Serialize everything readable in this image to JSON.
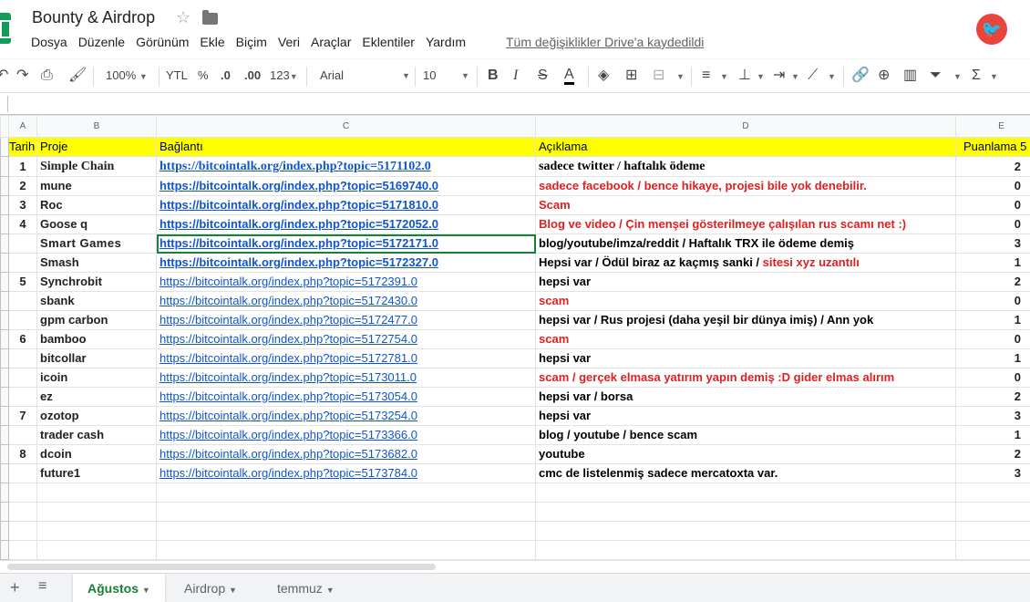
{
  "header": {
    "title": "Bounty & Airdrop",
    "saved_text": "Tüm değişiklikler Drive'a kaydedildi"
  },
  "menu": [
    "Dosya",
    "Düzenle",
    "Görünüm",
    "Ekle",
    "Biçim",
    "Veri",
    "Araçlar",
    "Eklentiler",
    "Yardım"
  ],
  "toolbar": {
    "zoom": "100%",
    "currency": "YTL",
    "percent": "%",
    "dec_less": ".0",
    "dec_more": ".00",
    "format": "123",
    "font": "Arial",
    "size": "10"
  },
  "columns": [
    "A",
    "B",
    "C",
    "D",
    "E"
  ],
  "header_row": {
    "a": "Tarih",
    "b": "Proje",
    "c": "Bağlantı",
    "d": "Açıklama",
    "e": "Puanlama 5"
  },
  "rows": [
    {
      "a": "1",
      "b": "Simple Chain",
      "c": "https://bitcointalk.org/index.php?topic=5171102.0",
      "d": "sadece twitter / haftalık ödeme",
      "d2": "",
      "e": "2"
    },
    {
      "a": "2",
      "b": "mune",
      "c": "https://bitcointalk.org/index.php?topic=5169740.0",
      "d": "",
      "d2": "sadece facebook / bence hikaye, projesi bile yok denebilir.",
      "e": "0"
    },
    {
      "a": "3",
      "b": "Roc",
      "c": "https://bitcointalk.org/index.php?topic=5171810.0",
      "d": "",
      "d2": "Scam",
      "e": "0"
    },
    {
      "a": "4",
      "b": "Goose q",
      "c": "https://bitcointalk.org/index.php?topic=5172052.0",
      "d": "",
      "d2": "Blog ve video / Çin menşei gösterilmeye çalışılan rus scamı net :)",
      "e": "0"
    },
    {
      "a": "",
      "b": "Smart Games",
      "c": "https://bitcointalk.org/index.php?topic=5172171.0",
      "d": "blog/youtube/imza/reddit / Haftalık TRX ile ödeme demiş",
      "d2": "",
      "e": "3"
    },
    {
      "a": "",
      "b": "Smash",
      "c": "https://bitcointalk.org/index.php?topic=5172327.0",
      "d": "Hepsi var / Ödül biraz az kaçmış sanki / ",
      "d2": "sitesi xyz uzantılı",
      "e": "1"
    },
    {
      "a": "5",
      "b": "Synchrobit",
      "c": "https://bitcointalk.org/index.php?topic=5172391.0",
      "d": "hepsi var",
      "d2": "",
      "e": "2"
    },
    {
      "a": "",
      "b": "sbank",
      "c": "https://bitcointalk.org/index.php?topic=5172430.0",
      "d": "",
      "d2": "scam",
      "e": "0"
    },
    {
      "a": "",
      "b": "gpm carbon",
      "c": "https://bitcointalk.org/index.php?topic=5172477.0",
      "d": "hepsi var / Rus projesi (daha yeşil bir dünya imiş) / Ann yok",
      "d2": "",
      "e": "1"
    },
    {
      "a": "6",
      "b": "bamboo",
      "c": "https://bitcointalk.org/index.php?topic=5172754.0",
      "d": "",
      "d2": "scam",
      "e": "0"
    },
    {
      "a": "",
      "b": "bitcollar",
      "c": "https://bitcointalk.org/index.php?topic=5172781.0",
      "d": "hepsi var",
      "d2": "",
      "e": "1"
    },
    {
      "a": "",
      "b": "icoin",
      "c": "https://bitcointalk.org/index.php?topic=5173011.0",
      "d": "",
      "d2": "scam / gerçek elmasa yatırım yapın demiş :D gider elmas alırım",
      "e": "0"
    },
    {
      "a": "",
      "b": "ez",
      "c": "https://bitcointalk.org/index.php?topic=5173054.0",
      "d": "hepsi var / borsa",
      "d2": "",
      "e": "2"
    },
    {
      "a": "7",
      "b": "ozotop",
      "c": "https://bitcointalk.org/index.php?topic=5173254.0",
      "d": "hepsi var",
      "d2": "",
      "e": "3"
    },
    {
      "a": "",
      "b": "trader cash",
      "c": "https://bitcointalk.org/index.php?topic=5173366.0",
      "d": "blog / youtube / bence scam",
      "d2": "",
      "e": "1"
    },
    {
      "a": "8",
      "b": "dcoin",
      "c": "https://bitcointalk.org/index.php?topic=5173682.0",
      "d": "youtube",
      "d2": "",
      "e": "2"
    },
    {
      "a": "",
      "b": "future1",
      "c": "https://bitcointalk.org/index.php?topic=5173784.0",
      "d": "cmc de listelenmiş sadece mercatoxta var.",
      "d2": "",
      "e": "3"
    }
  ],
  "tabs": [
    "Ağustos",
    "Airdrop",
    "temmuz"
  ],
  "colors": {
    "header_yellow": "#ffff00",
    "link": "#1155cc",
    "warn": "#e02020",
    "active_tab": "#188038"
  }
}
